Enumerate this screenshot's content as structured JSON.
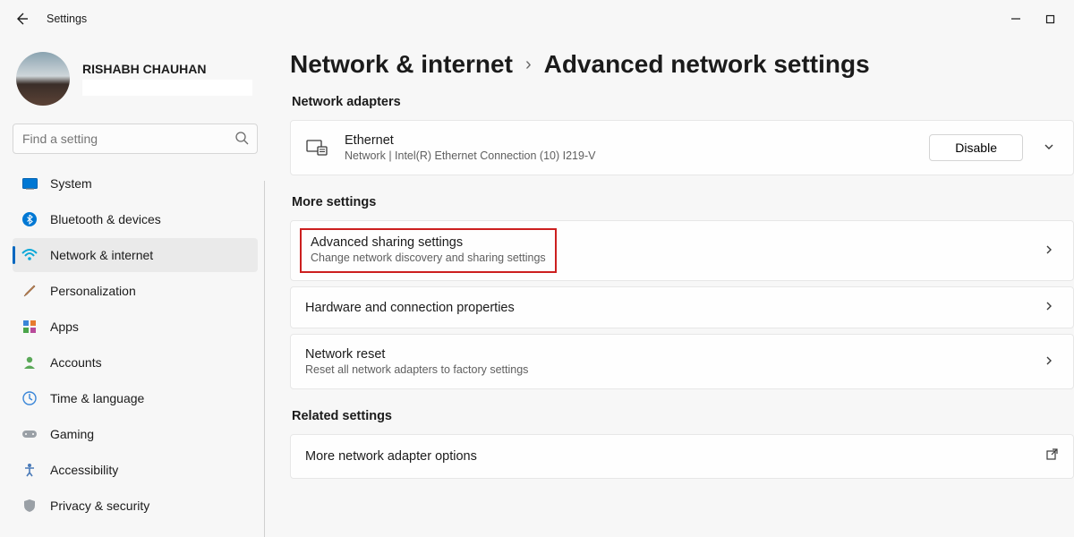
{
  "window": {
    "title": "Settings"
  },
  "profile": {
    "name": "RISHABH CHAUHAN"
  },
  "search": {
    "placeholder": "Find a setting"
  },
  "sidebar": {
    "items": [
      {
        "label": "System"
      },
      {
        "label": "Bluetooth & devices"
      },
      {
        "label": "Network & internet"
      },
      {
        "label": "Personalization"
      },
      {
        "label": "Apps"
      },
      {
        "label": "Accounts"
      },
      {
        "label": "Time & language"
      },
      {
        "label": "Gaming"
      },
      {
        "label": "Accessibility"
      },
      {
        "label": "Privacy & security"
      }
    ]
  },
  "breadcrumb": {
    "parent": "Network & internet",
    "current": "Advanced network settings"
  },
  "sections": {
    "adapters_title": "Network adapters",
    "more_title": "More settings",
    "related_title": "Related settings"
  },
  "ethernet": {
    "title": "Ethernet",
    "subtitle": "Network | Intel(R) Ethernet Connection (10) I219-V",
    "button": "Disable"
  },
  "more": {
    "sharing_title": "Advanced sharing settings",
    "sharing_sub": "Change network discovery and sharing settings",
    "hardware_title": "Hardware and connection properties",
    "reset_title": "Network reset",
    "reset_sub": "Reset all network adapters to factory settings"
  },
  "related": {
    "adapter_options": "More network adapter options"
  }
}
